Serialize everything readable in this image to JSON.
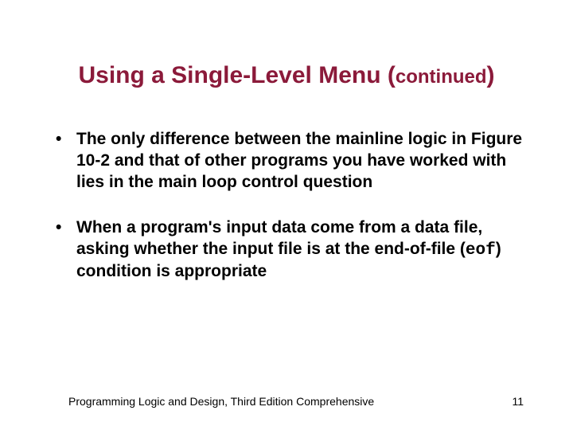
{
  "title": {
    "main": "Using a Single-Level Menu ",
    "open_paren": "(",
    "continued": "continued",
    "close_paren": ")"
  },
  "bullets": [
    {
      "text": "The only difference between the mainline logic in Figure 10-2 and that of other programs you have worked with lies in the main loop control question"
    },
    {
      "prefix": "When a program's input data come from a data file, asking whether the input file is at the end-of-file (",
      "code": "eof",
      "suffix": ") condition is appropriate"
    }
  ],
  "footer": {
    "book": "Programming Logic and Design, Third Edition Comprehensive",
    "page": "11"
  }
}
